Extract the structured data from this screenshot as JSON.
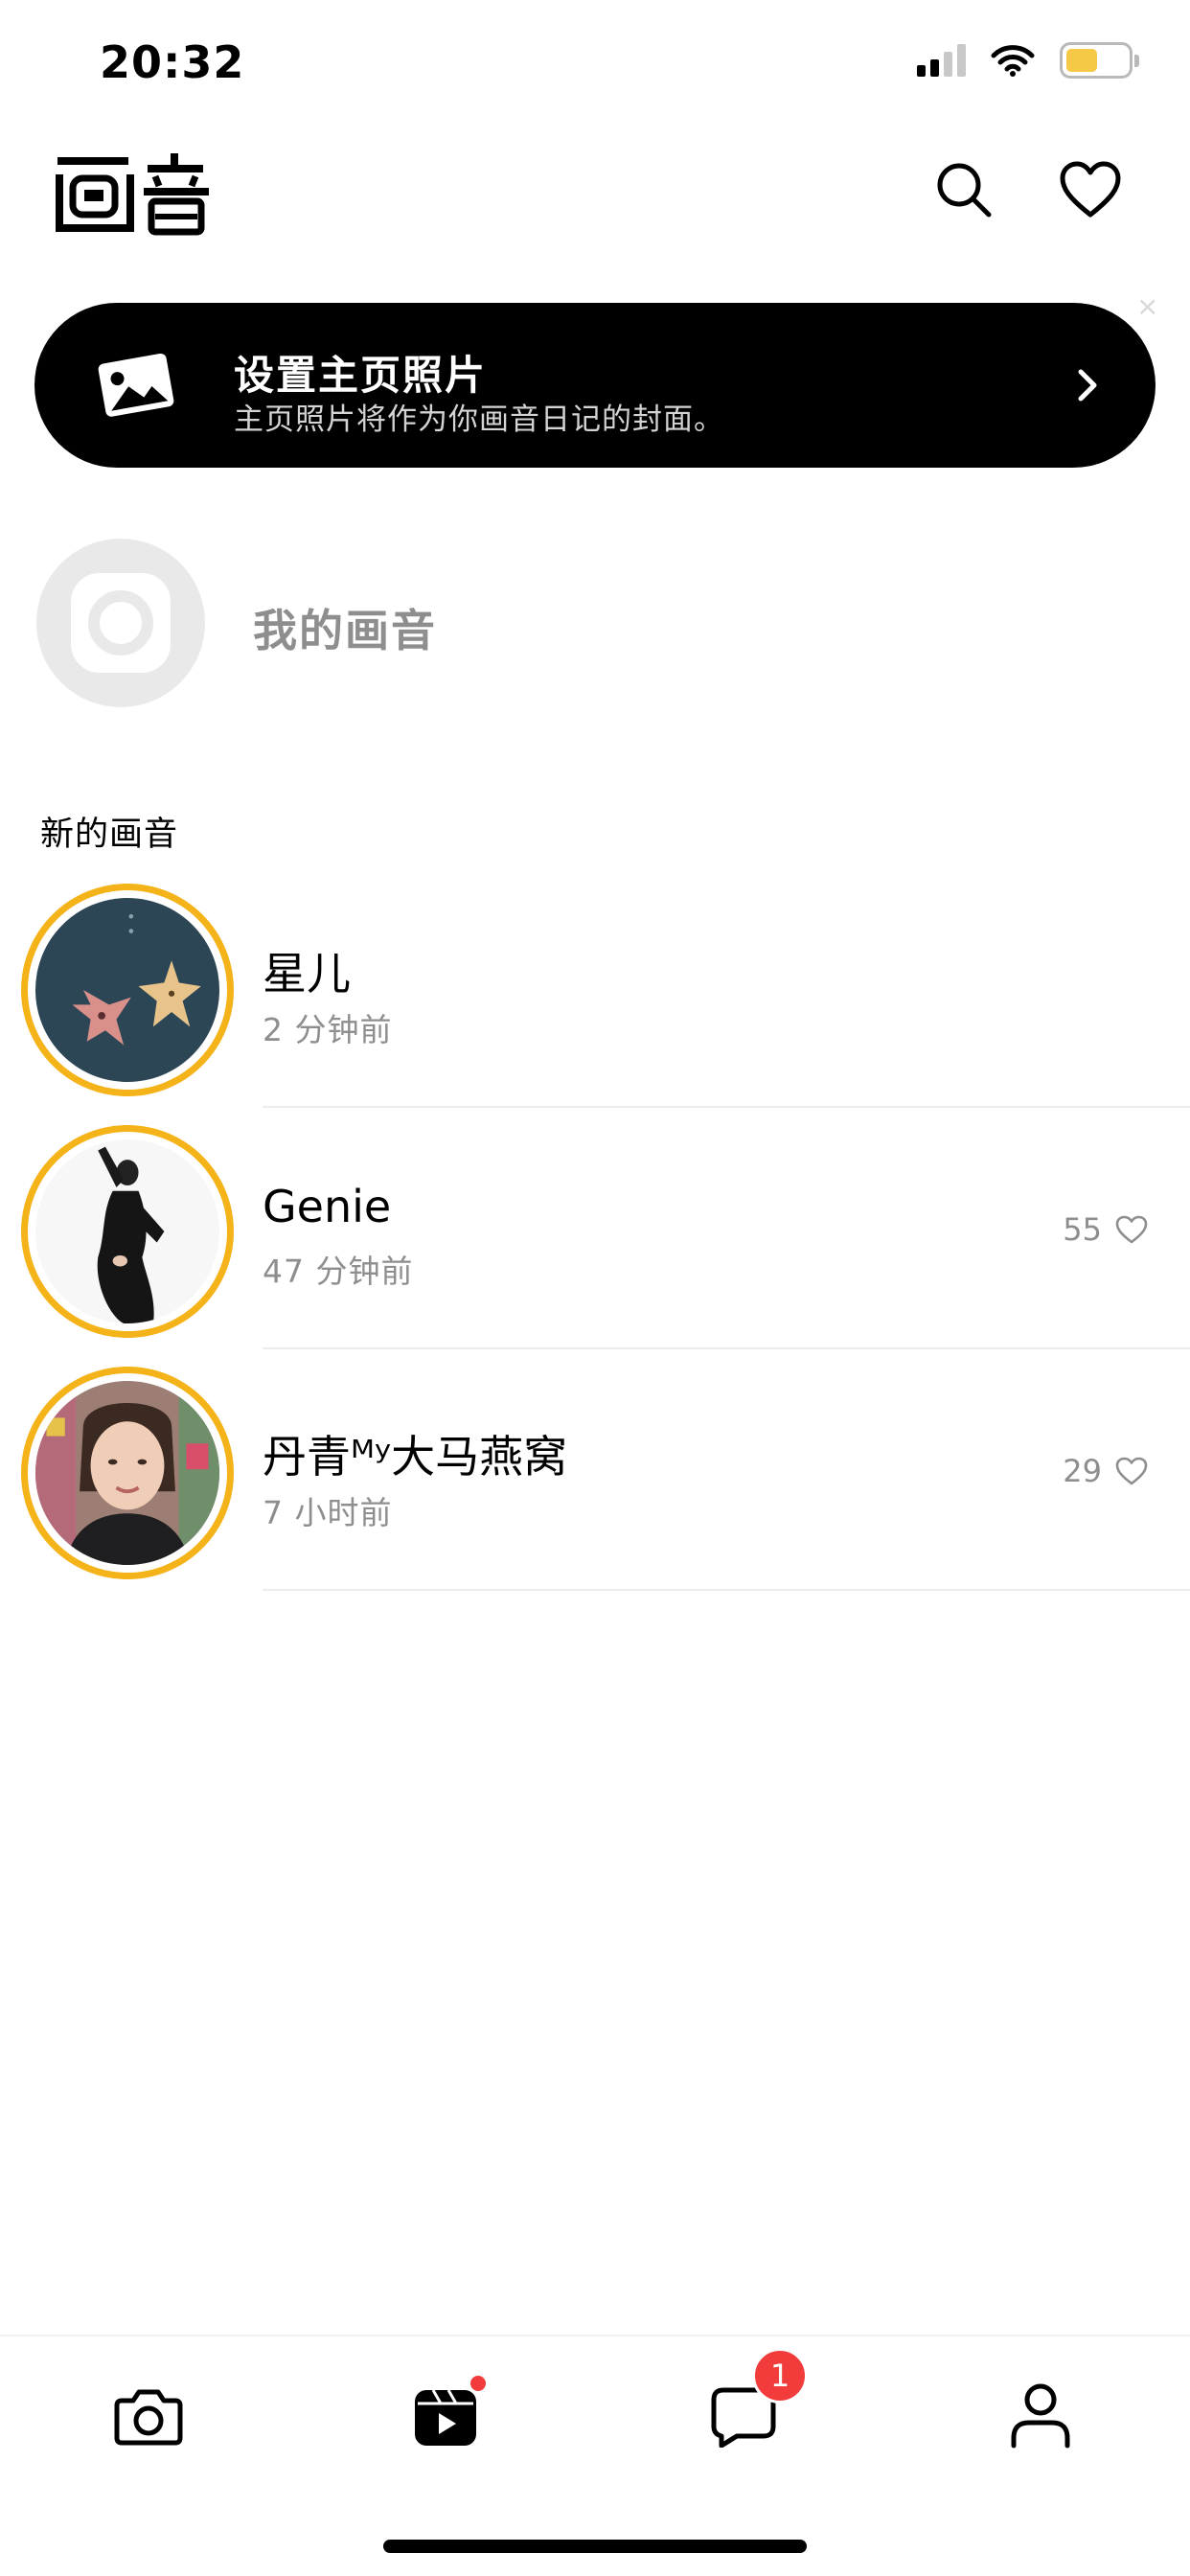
{
  "status_bar": {
    "time": "20:32",
    "battery_color": "#f5c945"
  },
  "header": {
    "logo_text": "画音",
    "search_icon": "search-icon",
    "favorites_icon": "heart-icon"
  },
  "banner": {
    "icon": "photo-icon",
    "title": "设置主页照片",
    "subtitle": "主页照片将作为你画音日记的封面。",
    "close_glyph": "×"
  },
  "my_profile": {
    "label": "我的画音"
  },
  "section": {
    "title": "新的画音"
  },
  "feed": [
    {
      "name": "星儿",
      "time": "2 分钟前",
      "likes": ""
    },
    {
      "name": "Genie",
      "time": "47 分钟前",
      "likes": "55"
    },
    {
      "name": "丹青ᴹʸ大马燕窝",
      "time": "7 小时前",
      "likes": "29"
    }
  ],
  "tabbar": {
    "tabs": [
      {
        "name": "camera-tab",
        "icon": "camera-icon"
      },
      {
        "name": "feed-tab",
        "icon": "play-icon",
        "dot": true
      },
      {
        "name": "messages-tab",
        "icon": "chat-icon",
        "badge": "1"
      },
      {
        "name": "profile-tab",
        "icon": "person-icon"
      }
    ]
  },
  "colors": {
    "accent_ring": "#f5b31a",
    "badge": "#f23b3b"
  }
}
